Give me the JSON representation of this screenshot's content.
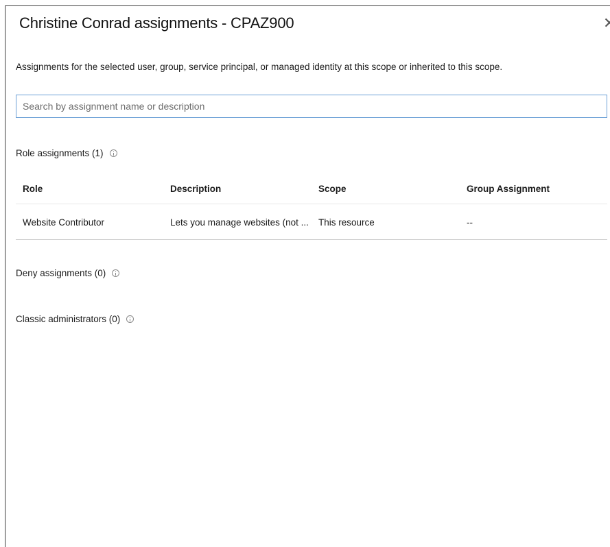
{
  "header": {
    "title": "Christine Conrad assignments - CPAZ900",
    "close_glyph": "✕"
  },
  "description": "Assignments for the selected user, group, service principal, or managed identity at this scope or inherited to this scope.",
  "search": {
    "placeholder": "Search by assignment name or description",
    "value": ""
  },
  "sections": {
    "role_assignments": "Role assignments (1)",
    "deny_assignments": "Deny assignments (0)",
    "classic_administrators": "Classic administrators (0)"
  },
  "role_table": {
    "columns": [
      "Role",
      "Description",
      "Scope",
      "Group Assignment"
    ],
    "rows": [
      {
        "role": "Website Contributor",
        "description": "Lets you manage websites (not ...",
        "scope": "This resource",
        "group_assignment": "--"
      }
    ]
  },
  "icons": {
    "info": "info-icon",
    "close": "close-icon"
  },
  "colors": {
    "link": "#2b76c9",
    "search_border": "#6a9fd6"
  }
}
